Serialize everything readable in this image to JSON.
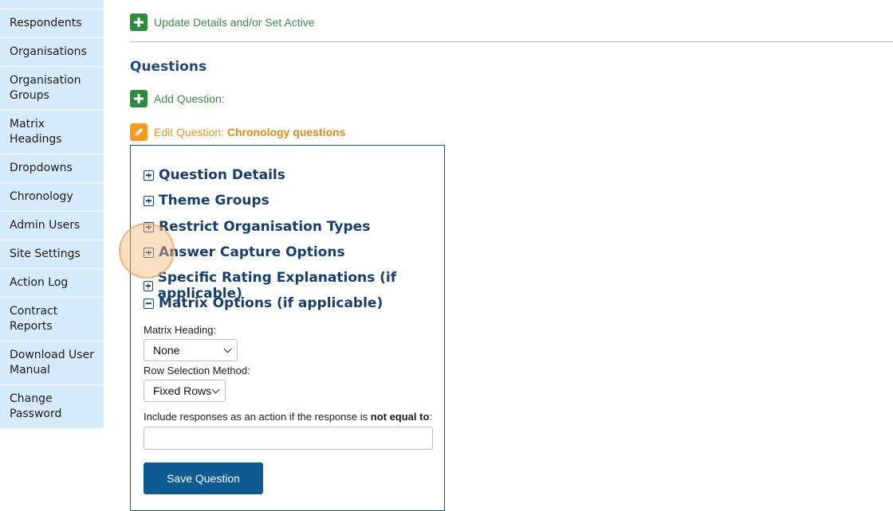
{
  "sidebar": {
    "items": [
      {
        "label": ""
      },
      {
        "label": "Respondents"
      },
      {
        "label": "Organisations"
      },
      {
        "label": "Organisation Groups"
      },
      {
        "label": "Matrix Headings"
      },
      {
        "label": "Dropdowns"
      },
      {
        "label": "Chronology"
      },
      {
        "label": "Admin Users"
      },
      {
        "label": "Site Settings"
      },
      {
        "label": "Action Log"
      },
      {
        "label": "Contract Reports"
      },
      {
        "label": "Download User Manual"
      },
      {
        "label": "Change Password"
      }
    ]
  },
  "actions": {
    "update_details": "Update Details and/or Set Active",
    "add_question": "Add Question:",
    "edit_question_prefix": "Edit Question:",
    "edit_question_name": "Chronology questions"
  },
  "section_title": "Questions",
  "panel": {
    "accordions": [
      {
        "label": "Question Details",
        "state": "collapsed"
      },
      {
        "label": "Theme Groups",
        "state": "collapsed"
      },
      {
        "label": "Restrict Organisation Types",
        "state": "collapsed"
      },
      {
        "label": "Answer Capture Options",
        "state": "collapsed"
      },
      {
        "label": "Specific Rating Explanations (if applicable)",
        "state": "collapsed"
      },
      {
        "label": "Matrix Options (if applicable)",
        "state": "expanded"
      }
    ],
    "matrix_heading_label": "Matrix Heading:",
    "matrix_heading_value": "None",
    "row_selection_label": "Row Selection Method:",
    "row_selection_value": "Fixed Rows",
    "include_responses_prefix": "Include responses as an action if the response is",
    "include_responses_bold": "not equal to",
    "include_responses_suffix": ":",
    "include_responses_value": "",
    "save_label": "Save Question"
  },
  "colors": {
    "sidebar_bg": "#d6ebfb",
    "green_action": "#2f8a3c",
    "orange_action": "#f39a1f",
    "heading_blue": "#1d4b80",
    "save_button": "#0e5a93"
  }
}
